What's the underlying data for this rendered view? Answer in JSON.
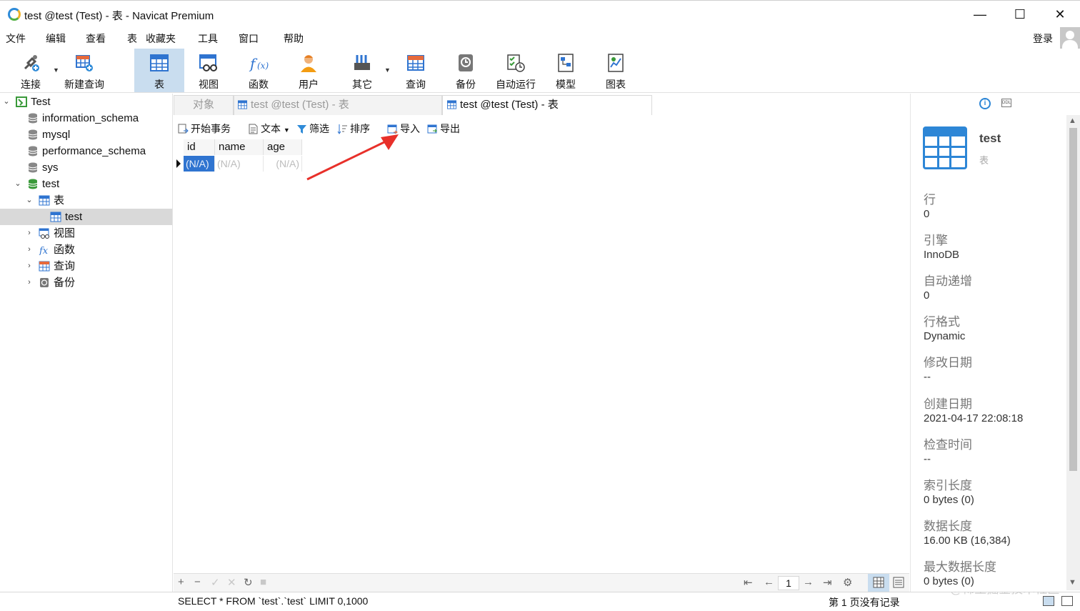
{
  "window": {
    "title": "test @test (Test) - 表 - Navicat Premium",
    "minimize": "—",
    "maximize": "☐",
    "close": "✕"
  },
  "menu": [
    "文件",
    "编辑",
    "查看",
    "表",
    "收藏夹",
    "工具",
    "窗口",
    "帮助"
  ],
  "login_label": "登录",
  "toolbar": [
    {
      "label": "连接",
      "icon": "connection-icon",
      "has_dropdown": true
    },
    {
      "label": "新建查询",
      "icon": "new-query-icon",
      "has_dropdown": false
    },
    {
      "label": "表",
      "icon": "table-icon",
      "has_dropdown": false,
      "active": true
    },
    {
      "label": "视图",
      "icon": "view-icon",
      "has_dropdown": false
    },
    {
      "label": "函数",
      "icon": "function-icon",
      "has_dropdown": false
    },
    {
      "label": "用户",
      "icon": "user-icon",
      "has_dropdown": false
    },
    {
      "label": "其它",
      "icon": "others-icon",
      "has_dropdown": true
    },
    {
      "label": "查询",
      "icon": "query-icon",
      "has_dropdown": false
    },
    {
      "label": "备份",
      "icon": "backup-icon",
      "has_dropdown": false
    },
    {
      "label": "自动运行",
      "icon": "automation-icon",
      "has_dropdown": false
    },
    {
      "label": "模型",
      "icon": "model-icon",
      "has_dropdown": false
    },
    {
      "label": "图表",
      "icon": "chart-icon",
      "has_dropdown": false
    }
  ],
  "tree": {
    "connection": "Test",
    "databases": [
      "information_schema",
      "mysql",
      "performance_schema",
      "sys",
      "test"
    ],
    "test_children": {
      "tables_label": "表",
      "table_items": [
        "test"
      ],
      "views_label": "视图",
      "functions_label": "函数",
      "queries_label": "查询",
      "backups_label": "备份"
    }
  },
  "tabs": [
    "对象",
    "test @test (Test) - 表",
    "test @test (Test) - 表"
  ],
  "subtoolbar": {
    "begin_transaction": "开始事务",
    "text": "文本",
    "filter": "筛选",
    "sort": "排序",
    "import": "导入",
    "export": "导出"
  },
  "grid": {
    "columns": [
      "id",
      "name",
      "age"
    ],
    "rows": [
      [
        "(N/A)",
        "(N/A)",
        "(N/A)"
      ]
    ]
  },
  "navbar": {
    "add": "+",
    "delete": "−",
    "apply": "✓",
    "cancel": "✕",
    "refresh": "↻",
    "stop": "■",
    "first": "⇤",
    "prev": "←",
    "page": "1",
    "next": "→",
    "last": "⇥",
    "settings": "⚙"
  },
  "status": {
    "sql": "SELECT * FROM `test`.`test` LIMIT 0,1000",
    "page_info": "第 1 页没有记录",
    "watermark": "@稀土掘金技术社区"
  },
  "info": {
    "name": "test",
    "type": "表",
    "info_tab_icon_text": "i",
    "ddl_tab_icon_text": "DDL",
    "properties": [
      {
        "label": "行",
        "value": "0"
      },
      {
        "label": "引擎",
        "value": "InnoDB"
      },
      {
        "label": "自动递增",
        "value": "0"
      },
      {
        "label": "行格式",
        "value": "Dynamic"
      },
      {
        "label": "修改日期",
        "value": "--"
      },
      {
        "label": "创建日期",
        "value": "2021-04-17 22:08:18"
      },
      {
        "label": "检查时间",
        "value": "--"
      },
      {
        "label": "索引长度",
        "value": "0 bytes (0)"
      },
      {
        "label": "数据长度",
        "value": "16.00 KB (16,384)"
      },
      {
        "label": "最大数据长度",
        "value": "0 bytes (0)"
      }
    ]
  },
  "colors": {
    "accent": "#2f74d0",
    "toolbar_active": "#c9ddef",
    "arrow": "#e8302a"
  }
}
